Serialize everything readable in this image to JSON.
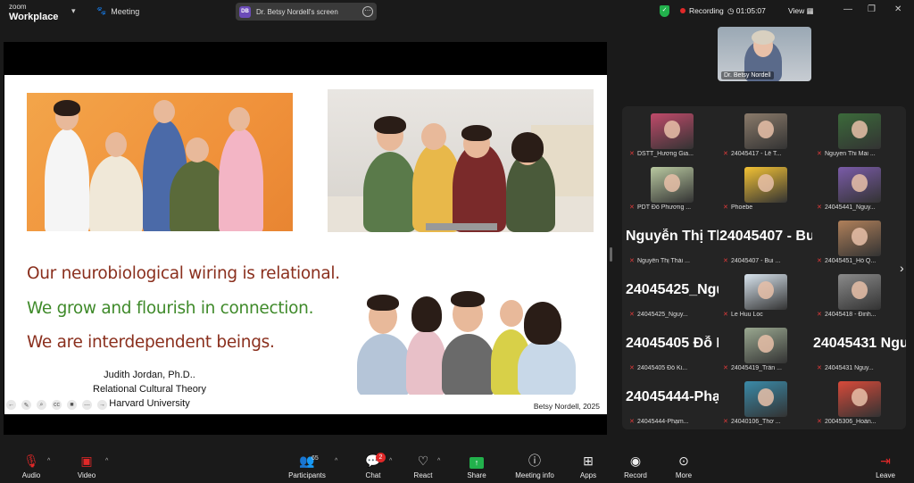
{
  "app": {
    "brand_top": "zoom",
    "brand_bottom": "Workplace",
    "meeting_label": "Meeting"
  },
  "share": {
    "badge": "DB",
    "title": "Dr. Betsy Nordell's screen"
  },
  "status": {
    "recording": "Recording",
    "timer": "01:05:07",
    "view": "View"
  },
  "slide": {
    "quote1": "Our neurobiological wiring is relational.",
    "quote2": "We grow and flourish in connection.",
    "quote3": "We are interdependent beings.",
    "cite_name": "Judith Jordan, Ph.D..",
    "cite_theory": "Relational Cultural Theory",
    "cite_univ": "Harvard University",
    "credit": "Betsy Nordell, 2025"
  },
  "presenter": {
    "name": "Dr. Betsy Nordell"
  },
  "gallery": {
    "tiles": [
      {
        "name": "",
        "label": "DSTT_Hương Gia...",
        "color": "#c04a6a"
      },
      {
        "name": "",
        "label": "24045417 - Lê T...",
        "color": "#8a7a6a"
      },
      {
        "name": "",
        "label": "Nguyen Thi Mai ...",
        "color": "#3b6a3a"
      },
      {
        "name": "",
        "label": "PDT Đỗ Phương ...",
        "color": "#b9c9a0"
      },
      {
        "name": "",
        "label": "Phoebe",
        "color": "#f3c234"
      },
      {
        "name": "",
        "label": "24045441_Nguy...",
        "color": "#7a5ba8"
      },
      {
        "name": "Nguyễn Thị Thá...",
        "label": "Nguyễn Thị Thái ...",
        "color": ""
      },
      {
        "name": "24045407 - Bui...",
        "label": "24045407 - Bui ...",
        "color": ""
      },
      {
        "name": "",
        "label": "24045451_Hồ Q...",
        "color": "#b0805a"
      },
      {
        "name": "24045425_Nguy...",
        "label": "24045425_Nguy...",
        "color": ""
      },
      {
        "name": "",
        "label": "Le Huu Loc",
        "color": "#d8e4ee"
      },
      {
        "name": "",
        "label": "24045418 - Đinh...",
        "color": "#8a8a8a"
      },
      {
        "name": "24045405 Đỗ Ki...",
        "label": "24045405 Đỗ Ki...",
        "color": ""
      },
      {
        "name": "",
        "label": "24045419_Trần ...",
        "color": "#9aa890"
      },
      {
        "name": "24045431 Nguy...",
        "label": "24045431 Nguy...",
        "color": ""
      },
      {
        "name": "24045444-Phạ...",
        "label": "24045444-Phạm...",
        "color": ""
      },
      {
        "name": "",
        "label": "24040106_Thơ ...",
        "color": "#3a8aa8"
      },
      {
        "name": "",
        "label": "20045306_Hoàn...",
        "color": "#d84a3a"
      }
    ]
  },
  "toolbar": {
    "audio": "Audio",
    "video": "Video",
    "participants": "Participants",
    "participants_count": "65",
    "chat": "Chat",
    "chat_badge": "2",
    "react": "React",
    "share": "Share",
    "meeting_info": "Meeting info",
    "apps": "Apps",
    "record": "Record",
    "more": "More",
    "leave": "Leave"
  },
  "colors": {
    "share_green": "#22b14c",
    "recording_red": "#e02828",
    "quote_red": "#8a2f1d",
    "quote_green": "#3f8a2a"
  }
}
